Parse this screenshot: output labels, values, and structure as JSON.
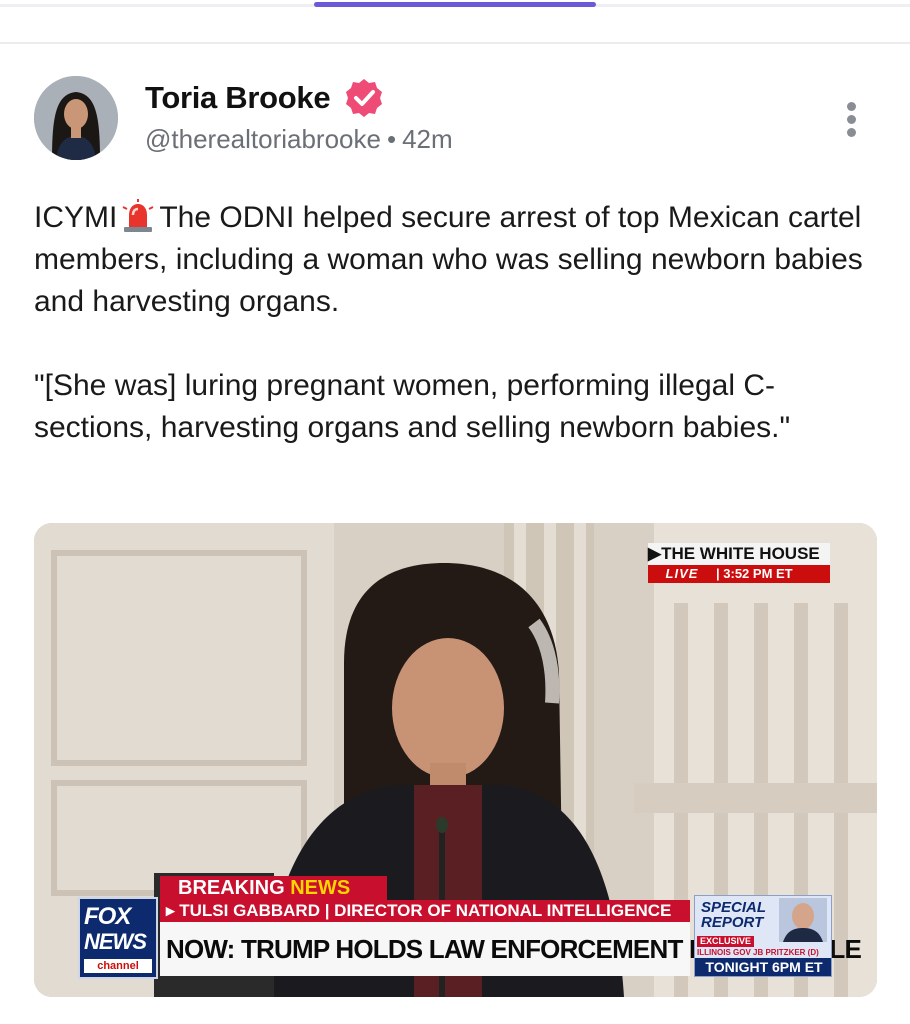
{
  "post": {
    "author_name": "Toria Brooke",
    "handle": "@therealtoriabrooke",
    "separator": "•",
    "time": "42m",
    "paragraph1_prefix": "ICYMI",
    "paragraph1_rest": "The ODNI helped secure arrest of top Mexican cartel members, including a woman who was selling newborn babies and harvesting organs.",
    "paragraph2": "\"[She was] luring pregnant women, performing illegal C-sections, harvesting organs and selling newborn babies.\""
  },
  "icons": {
    "verified": "verified-badge-icon",
    "more": "more-options-icon",
    "siren": "rotating-light-icon"
  },
  "media": {
    "bug_top": "▶THE WHITE HOUSE",
    "bug_live": "LIVE",
    "bug_sep": "|",
    "bug_time": "3:52 PM ET",
    "chyron_breaking": "BREAKING",
    "chyron_news": "NEWS",
    "chyron_sub": "▸ TULSI GABBARD | DIRECTOR OF NATIONAL INTELLIGENCE",
    "chyron_main": "NOW: TRUMP HOLDS LAW ENFORCEMENT ROUNDTABLE",
    "logo_line1": "FOX",
    "logo_line2": "NEWS",
    "logo_line3": "channel",
    "special_title": "SPECIAL REPORT",
    "special_exclusive": "EXCLUSIVE",
    "special_guest": "ILLINOIS GOV JB PRITZKER (D)",
    "special_time": "TONIGHT 6PM ET"
  },
  "colors": {
    "accent": "#6a59d9",
    "verified": "#ee4c77",
    "fox_red": "#c8102e",
    "fox_blue": "#0d2a6e"
  }
}
